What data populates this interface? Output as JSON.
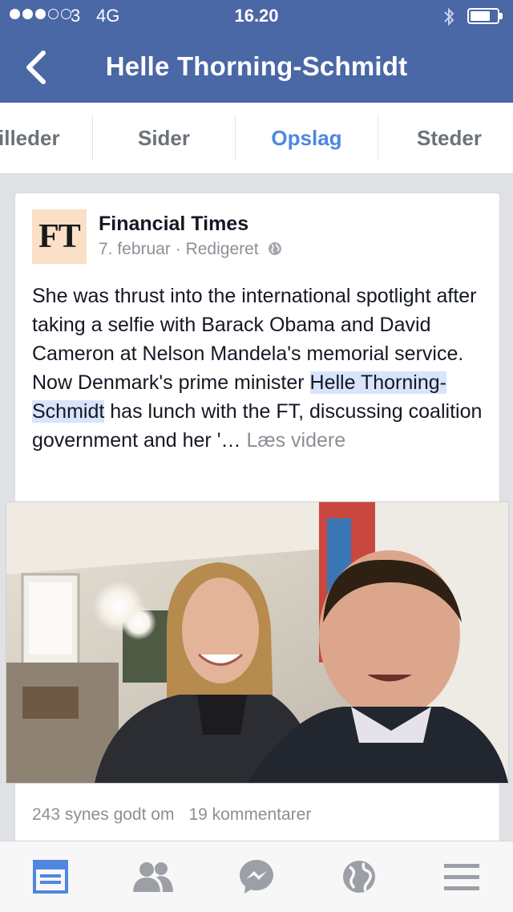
{
  "status_bar": {
    "signal_dots_filled": 3,
    "signal_dots_total": 5,
    "carrier": "3",
    "network": "4G",
    "time": "16.20",
    "battery_level": 0.7
  },
  "header": {
    "title": "Helle Thorning-Schmidt",
    "back_icon": "chevron-left-icon",
    "background": "#4a67a6"
  },
  "tabs": [
    {
      "label": "illeder",
      "active": false
    },
    {
      "label": "Sider",
      "active": false
    },
    {
      "label": "Opslag",
      "active": true
    },
    {
      "label": "Steder",
      "active": false
    }
  ],
  "post": {
    "source_logo_text": "FT",
    "source_name": "Financial Times",
    "date": "7. februar",
    "separator": "·",
    "edited": "Redigeret",
    "privacy_icon": "globe-icon",
    "text_before": "She was thrust into the international spotlight after taking a selfie with Barack Obama and David Cameron at Nelson Mandela's memorial service. Now Denmark's prime minister ",
    "highlight": "Helle Thorning-Schmidt",
    "text_after": " has lunch with the FT, discussing coalition government and her '…",
    "read_more": "Læs videre",
    "likes": "243 synes godt om",
    "comments": "19 kommentarer"
  },
  "bottom_nav": [
    {
      "icon": "news-feed-icon",
      "active": true
    },
    {
      "icon": "friends-icon",
      "active": false
    },
    {
      "icon": "messenger-icon",
      "active": false
    },
    {
      "icon": "globe-icon",
      "active": false
    },
    {
      "icon": "menu-icon",
      "active": false
    }
  ],
  "colors": {
    "accent": "#4f86e0",
    "ft_pink": "#fbe0c7",
    "highlight": "#d8e4fb"
  }
}
